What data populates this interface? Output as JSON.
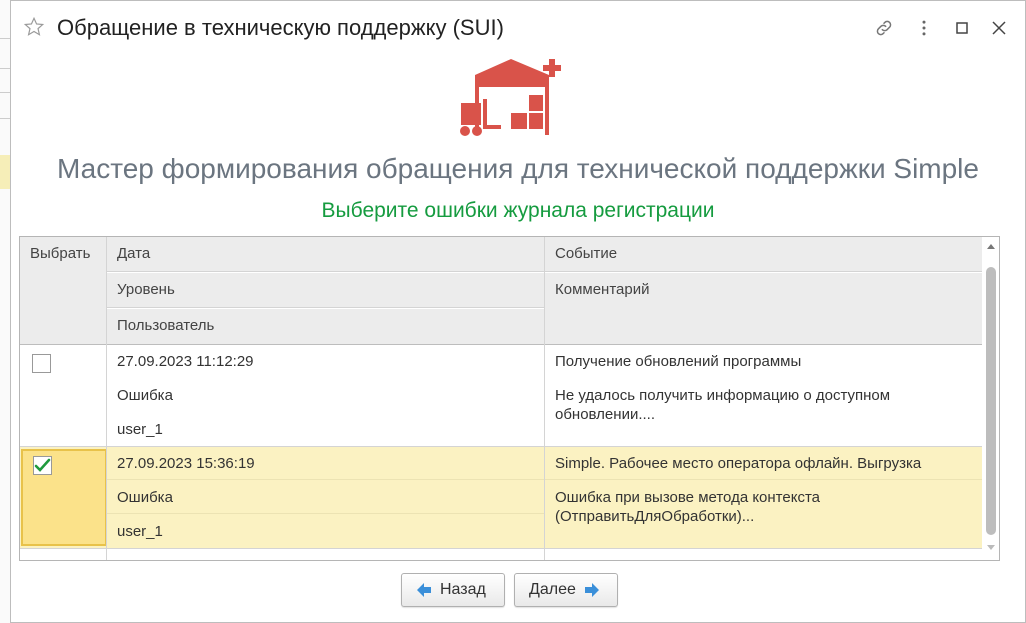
{
  "window": {
    "title": "Обращение в техническую поддержку (SUI)"
  },
  "wizard": {
    "heading": "Мастер формирования обращения для технической поддержки Simple",
    "subheading": "Выберите ошибки журнала регистрации"
  },
  "table": {
    "headers": {
      "select": "Выбрать",
      "date": "Дата",
      "level": "Уровень",
      "user": "Пользователь",
      "event": "Событие",
      "comment": "Комментарий"
    },
    "rows": [
      {
        "checked": false,
        "date": "27.09.2023 11:12:29",
        "level": "Ошибка",
        "user": "user_1",
        "event": "Получение обновлений программы",
        "comment_line1": "Не удалось получить информацию о доступном",
        "comment_line2": "обновлении...."
      },
      {
        "checked": true,
        "date": "27.09.2023 15:36:19",
        "level": "Ошибка",
        "user": "user_1",
        "event": "Simple. Рабочее место оператора офлайн. Выгрузка",
        "comment_line1": "Ошибка при вызове метода контекста",
        "comment_line2": "(ОтправитьДляОбработки)..."
      }
    ]
  },
  "buttons": {
    "back": "Назад",
    "next": "Далее"
  },
  "colors": {
    "accent_green": "#159b3f",
    "logo_red": "#d9534a",
    "selected_row": "#fbf2c2",
    "nav_arrow_blue": "#3a8fd9"
  }
}
